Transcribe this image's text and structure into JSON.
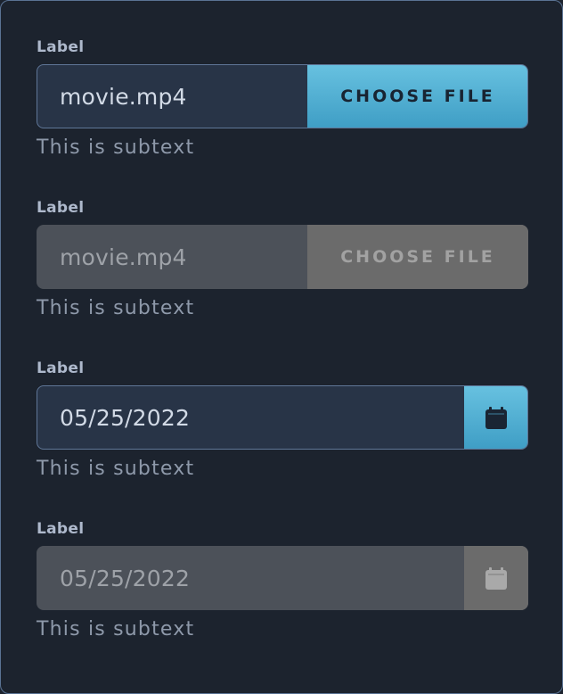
{
  "fields": [
    {
      "label": "Label",
      "value": "movie.mp4",
      "button_label": "CHOOSE FILE",
      "subtext": "This is subtext",
      "state": "enabled"
    },
    {
      "label": "Label",
      "value": "movie.mp4",
      "button_label": "CHOOSE FILE",
      "subtext": "This is subtext",
      "state": "disabled"
    },
    {
      "label": "Label",
      "value": "05/25/2022",
      "icon": "calendar-icon",
      "subtext": "This is subtext",
      "state": "enabled"
    },
    {
      "label": "Label",
      "value": "05/25/2022",
      "icon": "calendar-icon",
      "subtext": "This is subtext",
      "state": "disabled"
    }
  ],
  "colors": {
    "background": "#1c232e",
    "accent": "#4fb0d6",
    "input_bg": "#283447",
    "disabled_bg": "#4c5159",
    "disabled_button": "#6b6b6b"
  }
}
